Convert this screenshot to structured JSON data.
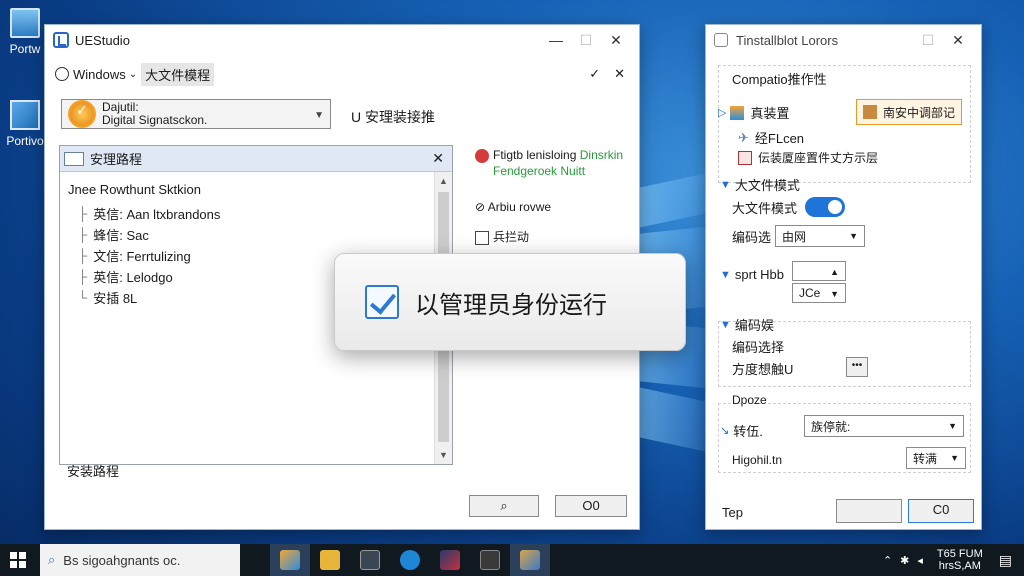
{
  "desktop": {
    "icons": [
      {
        "label": "Portw"
      },
      {
        "label": "Portivo"
      }
    ]
  },
  "main_window": {
    "title": "UEStudio",
    "subbar": {
      "windows_label": "Windows",
      "chip_label": "大文件模程"
    },
    "certificate": {
      "line1": "Dajutil:",
      "line2": "Digital Signatsckon."
    },
    "right_label": "U 安理装接推",
    "list_panel": {
      "header": "安理路程",
      "title": "Jnee Rowthunt Sktkion",
      "items": [
        {
          "label": "英信: Aan ltxbrandons"
        },
        {
          "label": "蜂信: Sac"
        },
        {
          "label": "文信: Ferrtulizing"
        },
        {
          "label": "英信: Lelodgo"
        },
        {
          "label": "安插 8L"
        }
      ]
    },
    "side_info": {
      "line1": "Ftigtb lenisloing",
      "line1_green": "Dinsrkin",
      "line2": "Fendgeroek Nuitt",
      "line3": "Arbiu rovwe",
      "line4": "兵拦动"
    },
    "bottom_label": "安装路程",
    "buttons": {
      "search_symbol": "⌕",
      "ok_label": "O0"
    }
  },
  "popup": {
    "label": "以管理员身份运行",
    "checked": true
  },
  "settings_window": {
    "title": "Tinstallblot Lorors",
    "section1": "Compatio推作性",
    "items": [
      {
        "label": "真装置"
      },
      {
        "label": "经FLcen"
      },
      {
        "label": "伝装厦座置件丈方示层"
      }
    ],
    "orange_button": "南安中调部记",
    "section2": "大文件模式",
    "toggle_label": "大文件模式",
    "toggle_on": true,
    "encoding_label": "编码选",
    "encoding_value": "由网",
    "sprt_label": "sprt Hbb",
    "sprt_select1": "",
    "sprt_select2": "JCe",
    "group3_title": "编码娱",
    "group3_line1": "编码选择",
    "group3_line2": "方度想触U",
    "group3_button": "•••",
    "dpcze_title": "Dpoze",
    "transfer_label": "转伍.",
    "transfer_value": "族停就:",
    "highch_label": "Higohil.tn",
    "highch_button": "转满",
    "footer_label": "Tep",
    "ok_label": "C0"
  },
  "taskbar": {
    "search_text": "Bs sigoahgnants oc.",
    "clock_time": "T65 FUM",
    "clock_date": "hrsS,AM"
  }
}
